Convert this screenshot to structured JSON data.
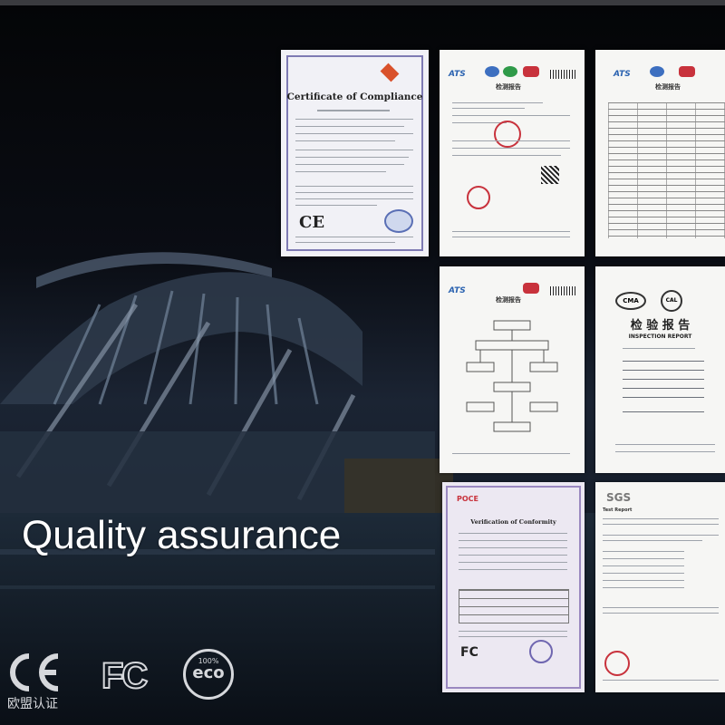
{
  "caption": "Quality assurance",
  "marks": {
    "ce_label": "欧盟认证",
    "fc_text": "FC",
    "eco_top": "100%",
    "eco_word": "eco"
  },
  "documents": {
    "compliance": {
      "title": "Certificate of Compliance",
      "mark": "CE"
    },
    "ats_report_1": {
      "logo": "ATS",
      "title": "检测报告"
    },
    "ats_report_2": {
      "logo": "ATS",
      "title": "检测报告"
    },
    "ats_report_3": {
      "logo": "ATS",
      "title": "检测报告"
    },
    "inspection": {
      "seals": [
        "CMA",
        "CAL"
      ],
      "title_cn": "检 验 报 告",
      "title_en": "INSPECTION REPORT"
    },
    "conformity": {
      "brand": "POCE",
      "title": "Verification of Conformity",
      "mark": "FC"
    },
    "sgs": {
      "logo": "SGS",
      "title": "Test Report"
    }
  },
  "colors": {
    "background": "#07090d",
    "caption": "#ffffff",
    "paper": "#f6f6f4",
    "stamp_red": "#c8323c",
    "ats_blue": "#2a62b0"
  }
}
